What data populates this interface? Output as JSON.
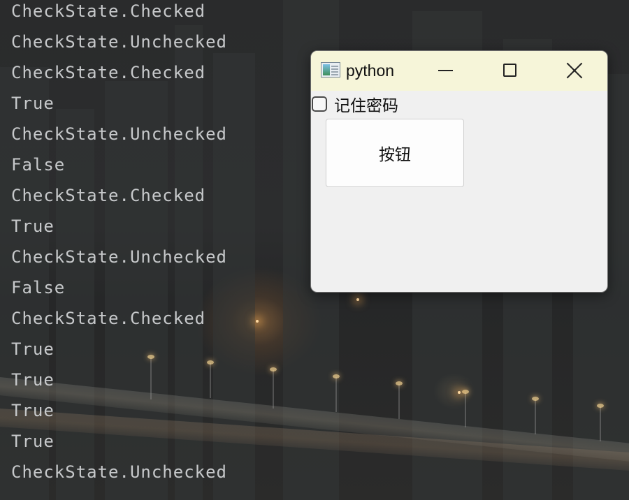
{
  "console": {
    "lines": [
      "CheckState.Checked",
      "CheckState.Unchecked",
      "CheckState.Checked",
      "True",
      "CheckState.Unchecked",
      "False",
      "CheckState.Checked",
      "True",
      "CheckState.Unchecked",
      "False",
      "CheckState.Checked",
      "True",
      "True",
      "True",
      "True",
      "CheckState.Unchecked"
    ]
  },
  "window": {
    "title": "python",
    "icon": "python-app-icon",
    "controls": {
      "minimize": "minimize-icon",
      "maximize": "maximize-icon",
      "close": "close-icon"
    },
    "checkbox": {
      "label": "记住密码",
      "checked": false
    },
    "button": {
      "label": "按钮"
    },
    "colors": {
      "titlebar": "#f6f5d9",
      "client": "#f0f0f0"
    }
  }
}
